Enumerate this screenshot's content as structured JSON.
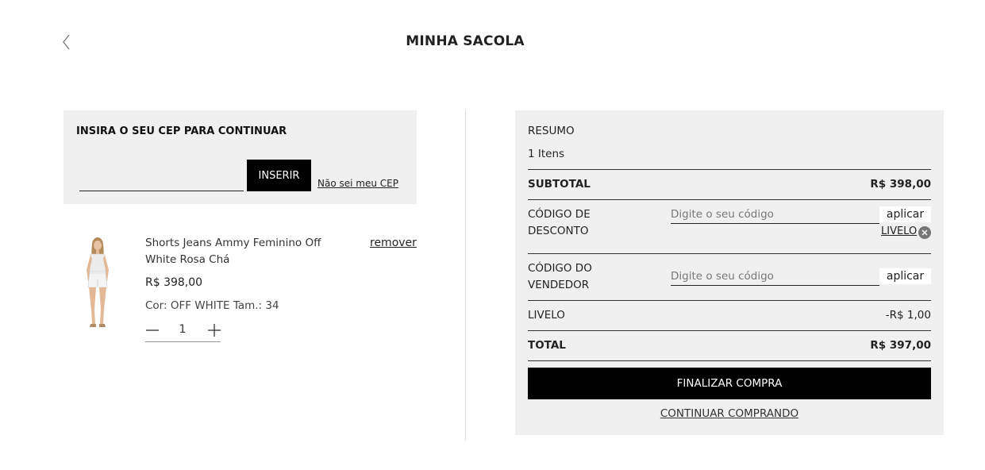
{
  "header": {
    "title": "MINHA SACOLA",
    "back_icon": "chevron-left-icon"
  },
  "cep": {
    "title": "INSIRA O SEU CEP PARA CONTINUAR",
    "input_value": "",
    "button_label": "INSERIR",
    "help_link": "Não sei meu CEP"
  },
  "cart": {
    "items": [
      {
        "name": "Shorts Jeans Ammy Feminino Off White Rosa Chá",
        "price": "R$ 398,00",
        "attributes": "Cor: OFF WHITE Tam.: 34",
        "quantity": "1",
        "remove_label": "remover"
      }
    ]
  },
  "summary": {
    "title": "RESUMO",
    "items_count": "1 Itens",
    "subtotal_label": "SUBTOTAL",
    "subtotal_value": "R$ 398,00",
    "discount_label_1": "CÓDIGO DE",
    "discount_label_2": "DESCONTO",
    "discount_placeholder": "Digite o seu código",
    "discount_apply": "aplicar",
    "applied_coupon": "LIVELO",
    "seller_label_1": "CÓDIGO DO",
    "seller_label_2": "VENDEDOR",
    "seller_placeholder": "Digite o seu código",
    "seller_apply": "aplicar",
    "coupon_line_label": "LIVELO",
    "coupon_line_value": "-R$ 1,00",
    "total_label": "TOTAL",
    "total_value": "R$ 397,00",
    "finish_button": "FINALIZAR COMPRA",
    "continue_link": "CONTINUAR COMPRANDO"
  },
  "colors": {
    "panel_bg": "#f0f0f0",
    "primary_button": "#000000",
    "text": "#222222"
  }
}
